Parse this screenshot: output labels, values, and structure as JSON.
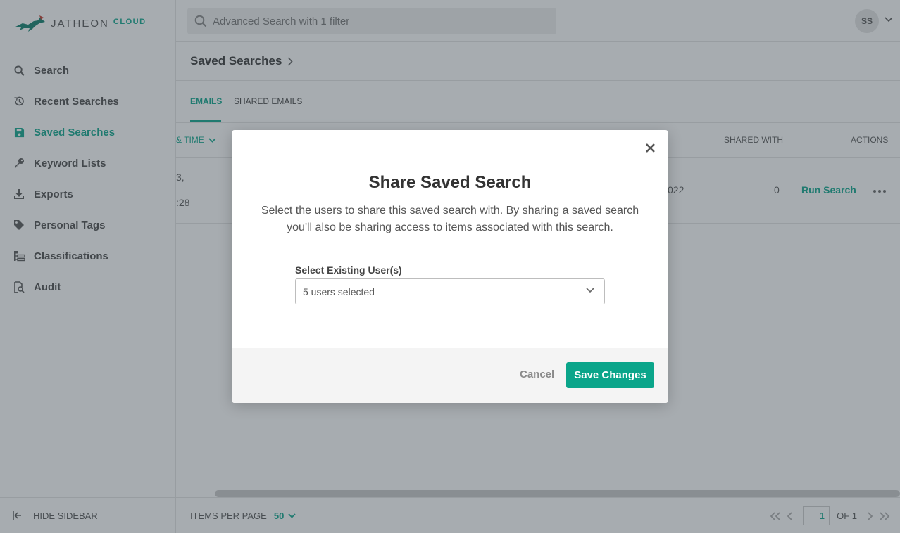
{
  "brand": {
    "name": "JATHEON",
    "sub": "CLOUD",
    "accent": "#0aa58a"
  },
  "sidebar": {
    "items": [
      {
        "label": "Search",
        "icon": "search-icon"
      },
      {
        "label": "Recent Searches",
        "icon": "history-icon"
      },
      {
        "label": "Saved Searches",
        "icon": "save-icon",
        "active": true
      },
      {
        "label": "Keyword Lists",
        "icon": "key-icon"
      },
      {
        "label": "Exports",
        "icon": "download-icon"
      },
      {
        "label": "Personal Tags",
        "icon": "tag-icon"
      },
      {
        "label": "Classifications",
        "icon": "hierarchy-icon"
      },
      {
        "label": "Audit",
        "icon": "audit-icon"
      }
    ],
    "hide_label": "HIDE SIDEBAR"
  },
  "header": {
    "search_placeholder": "Advanced Search with 1 filter",
    "avatar_initials": "SS"
  },
  "page": {
    "title": "Saved Searches"
  },
  "tabs": [
    {
      "label": "EMAILS",
      "active": true
    },
    {
      "label": "SHARED EMAILS"
    }
  ],
  "table": {
    "headers": {
      "date_time": "& TIME",
      "shared_with": "SHARED WITH",
      "actions": "ACTIONS"
    },
    "row": {
      "date_line1": "3,",
      "date_line2": ":28",
      "date_partial": "022",
      "shared_with": "0",
      "run_label": "Run Search"
    }
  },
  "footer": {
    "items_per_page_label": "ITEMS PER PAGE",
    "items_per_page_value": "50",
    "current_page": "1",
    "of_label": "OF 1"
  },
  "modal": {
    "title": "Share Saved Search",
    "description": "Select the users to share this saved search with. By sharing a saved search you'll also be sharing access to items associated with this search.",
    "field_label": "Select Existing User(s)",
    "selected_value": "5 users selected",
    "cancel_label": "Cancel",
    "save_label": "Save Changes"
  }
}
